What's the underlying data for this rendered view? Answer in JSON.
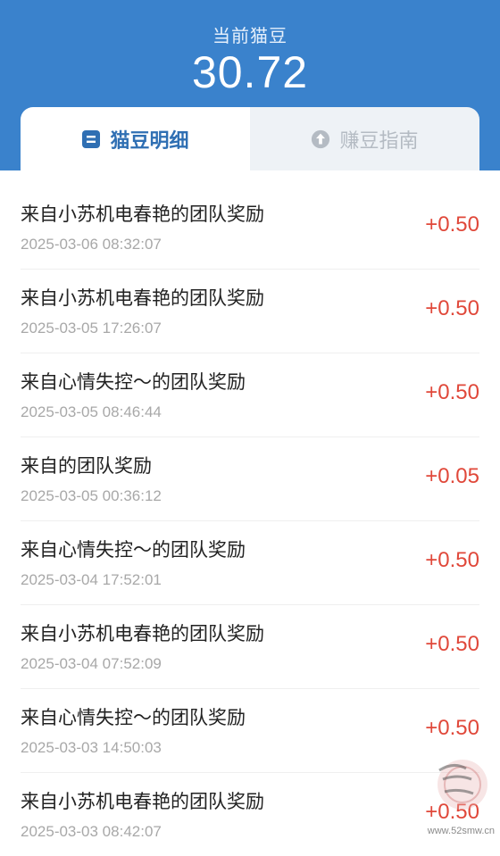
{
  "header": {
    "balance_label": "当前猫豆",
    "balance_value": "30.72"
  },
  "tabs": [
    {
      "label": "猫豆明细",
      "icon": "list-icon",
      "active": true
    },
    {
      "label": "赚豆指南",
      "icon": "arrow-up-circle-icon",
      "active": false
    }
  ],
  "records": [
    {
      "title": "来自小苏机电春艳的团队奖励",
      "time": "2025-03-06 08:32:07",
      "amount": "+0.50"
    },
    {
      "title": "来自小苏机电春艳的团队奖励",
      "time": "2025-03-05 17:26:07",
      "amount": "+0.50"
    },
    {
      "title": "来自心情失控～的团队奖励",
      "time": "2025-03-05 08:46:44",
      "amount": "+0.50"
    },
    {
      "title": "来自的团队奖励",
      "time": "2025-03-05 00:36:12",
      "amount": "+0.05"
    },
    {
      "title": "来自心情失控～的团队奖励",
      "time": "2025-03-04 17:52:01",
      "amount": "+0.50"
    },
    {
      "title": "来自小苏机电春艳的团队奖励",
      "time": "2025-03-04 07:52:09",
      "amount": "+0.50"
    },
    {
      "title": "来自心情失控～的团队奖励",
      "time": "2025-03-03 14:50:03",
      "amount": "+0.50"
    },
    {
      "title": "来自小苏机电春艳的团队奖励",
      "time": "2025-03-03 08:42:07",
      "amount": "+0.50"
    }
  ],
  "watermark": {
    "text": "www.52smw.cn"
  },
  "colors": {
    "header_blue": "#3a82cc",
    "accent_blue": "#2f6fb3",
    "amount_red": "#e0483a"
  }
}
